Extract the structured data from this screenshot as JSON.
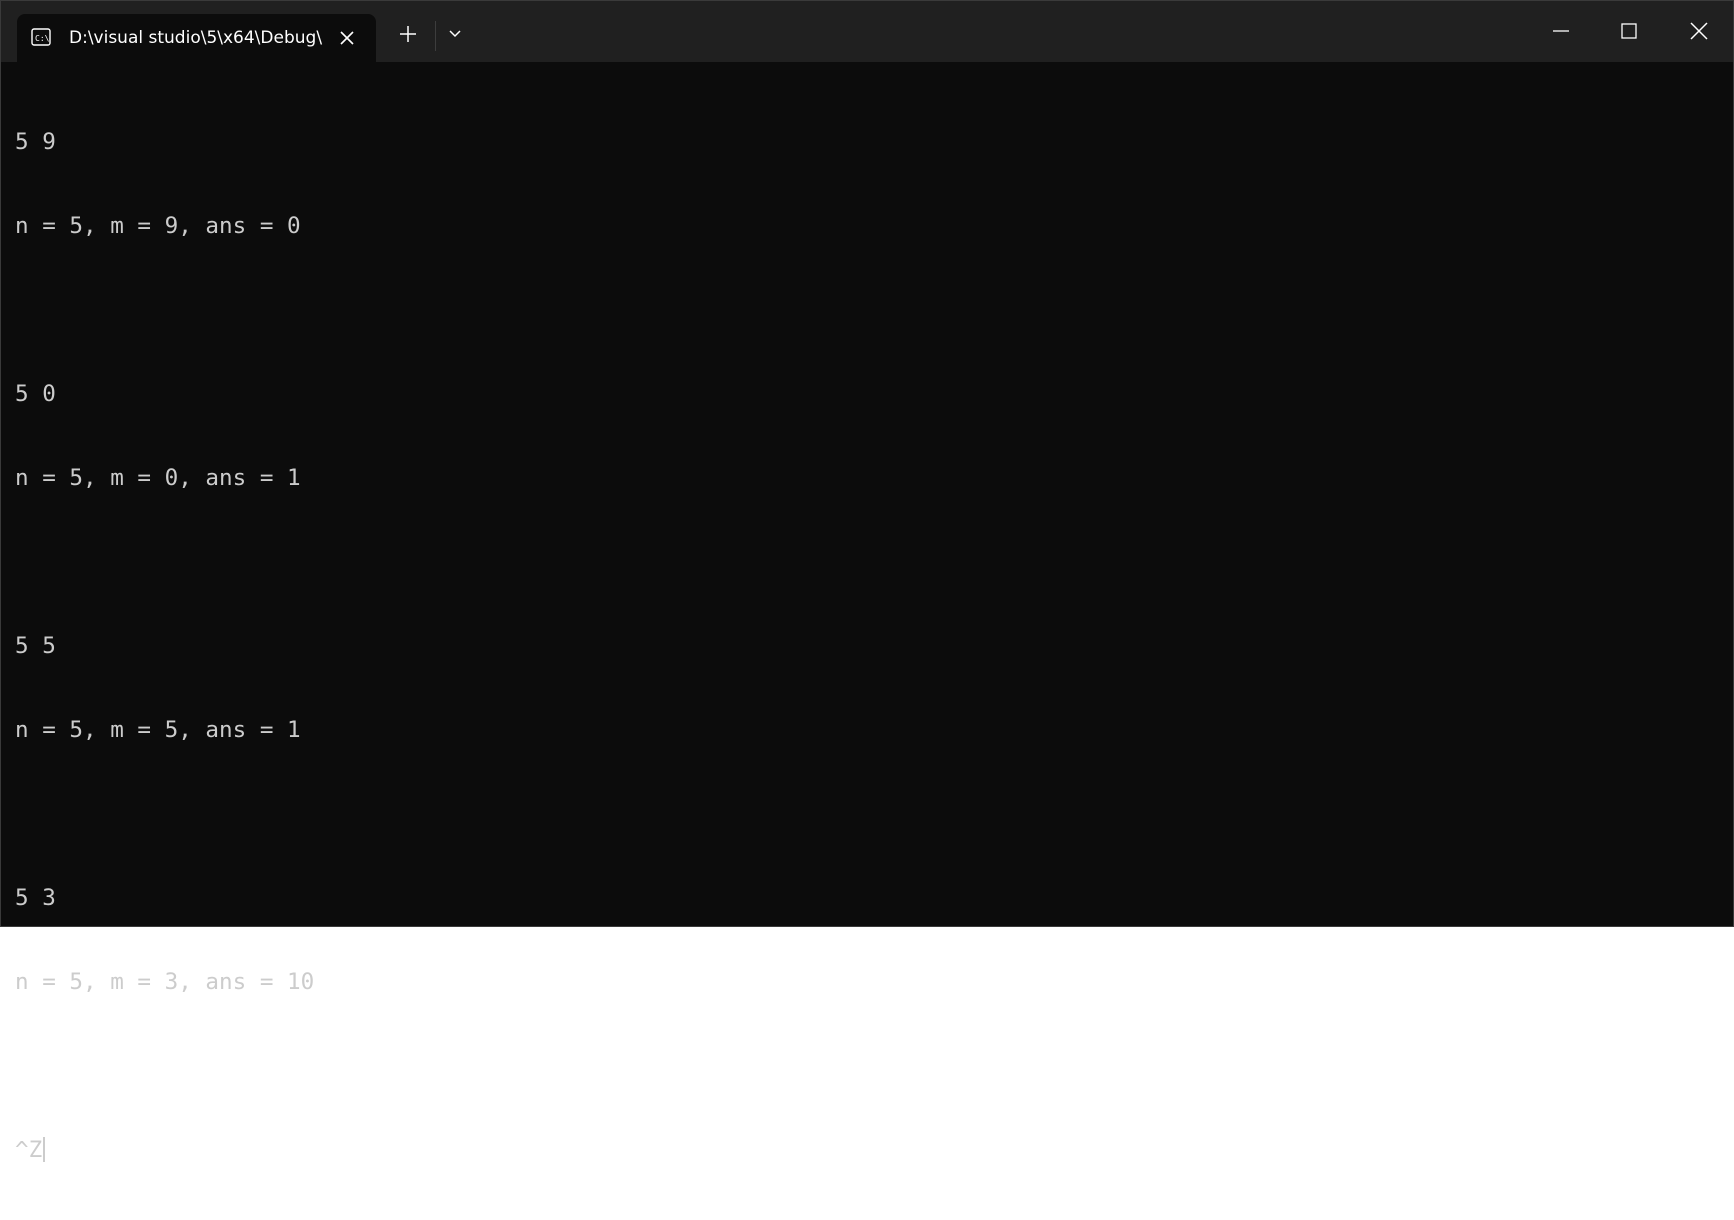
{
  "window": {
    "tab_title": "D:\\visual studio\\5\\x64\\Debug\\",
    "tab_icon": "console-icon",
    "buttons": [
      "close-tab-icon",
      "new-tab-icon",
      "dropdown-chevron-icon",
      "minimize-icon",
      "maximize-icon",
      "close-window-icon"
    ]
  },
  "console": {
    "lines": [
      "5 9",
      "n = 5, m = 9, ans = 0",
      "",
      "5 0",
      "n = 5, m = 0, ans = 1",
      "",
      "5 5",
      "n = 5, m = 5, ans = 1",
      "",
      "5 3",
      "n = 5, m = 3, ans = 10",
      "",
      "^Z"
    ]
  },
  "colors": {
    "background": "#0c0c0c",
    "titlebar": "#202020",
    "text": "#cccccc",
    "title_text": "#ffffff"
  }
}
